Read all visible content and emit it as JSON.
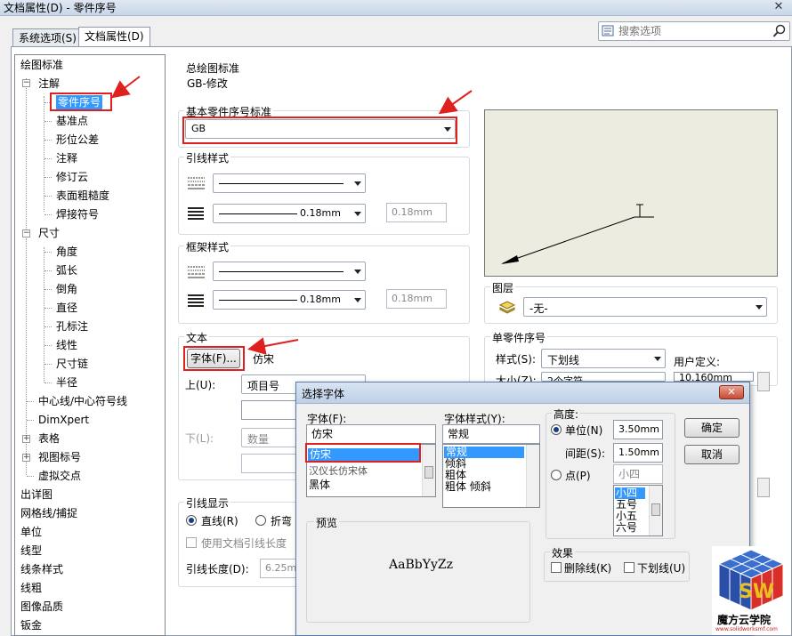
{
  "window": {
    "title": "文档属性(D) - 零件序号",
    "close_glyph": "✕"
  },
  "tabs": [
    {
      "label": "系统选项(S)",
      "active": false
    },
    {
      "label": "文档属性(D)",
      "active": true
    }
  ],
  "search": {
    "placeholder": "搜索选项"
  },
  "tree": {
    "items": [
      {
        "label": "绘图标准",
        "level": 0
      },
      {
        "label": "注解",
        "level": 1,
        "expander": "−"
      },
      {
        "label": "零件序号",
        "level": 2,
        "selected": true
      },
      {
        "label": "基准点",
        "level": 2
      },
      {
        "label": "形位公差",
        "level": 2
      },
      {
        "label": "注释",
        "level": 2
      },
      {
        "label": "修订云",
        "level": 2
      },
      {
        "label": "表面粗糙度",
        "level": 2
      },
      {
        "label": "焊接符号",
        "level": 2
      },
      {
        "label": "尺寸",
        "level": 1,
        "expander": "−"
      },
      {
        "label": "角度",
        "level": 2
      },
      {
        "label": "弧长",
        "level": 2
      },
      {
        "label": "倒角",
        "level": 2
      },
      {
        "label": "直径",
        "level": 2
      },
      {
        "label": "孔标注",
        "level": 2
      },
      {
        "label": "线性",
        "level": 2
      },
      {
        "label": "尺寸链",
        "level": 2
      },
      {
        "label": "半径",
        "level": 2
      },
      {
        "label": "中心线/中心符号线",
        "level": 1
      },
      {
        "label": "DimXpert",
        "level": 1
      },
      {
        "label": "表格",
        "level": 1,
        "expander": "+"
      },
      {
        "label": "视图标号",
        "level": 1,
        "expander": "+"
      },
      {
        "label": "虚拟交点",
        "level": 1
      },
      {
        "label": "出详图",
        "level": 0
      },
      {
        "label": "网格线/捕捉",
        "level": 0
      },
      {
        "label": "单位",
        "level": 0
      },
      {
        "label": "线型",
        "level": 0
      },
      {
        "label": "线条样式",
        "level": 0
      },
      {
        "label": "线粗",
        "level": 0
      },
      {
        "label": "图像品质",
        "level": 0
      },
      {
        "label": "钣金",
        "level": 0
      }
    ]
  },
  "overall_standard": {
    "label": "总绘图标准",
    "value": "GB-修改"
  },
  "base_standard": {
    "label": "基本零件序号标准",
    "value": "GB"
  },
  "leader_style": {
    "label": "引线样式",
    "thickness": "0.18mm",
    "custom": "0.18mm"
  },
  "frame_style": {
    "label": "框架样式",
    "thickness": "0.18mm",
    "custom": "0.18mm"
  },
  "text_group": {
    "label": "文本",
    "font_button": "字体(F)...",
    "font_name": "仿宋",
    "upper_label": "上(U):",
    "upper_value": "项目号",
    "lower_label": "下(L):",
    "lower_value": "数量"
  },
  "leader_display": {
    "label": "引线显示",
    "straight": "直线(R)",
    "bent": "折弯",
    "use_doc_length": "使用文档引线长度",
    "length_label": "引线长度(D):",
    "length_value": "6.25mm"
  },
  "layer": {
    "label": "图层",
    "value": "-无-"
  },
  "single_balloon": {
    "label": "单零件序号",
    "style_label": "样式(S):",
    "style_value": "下划线",
    "user_defined": "用户定义:",
    "size_label": "大小(Z):",
    "size_value": "2个字符",
    "user_value": "10.160mm"
  },
  "font_dialog": {
    "title": "选择字体",
    "close_glyph": "✕",
    "font_label": "字体(F):",
    "font_value": "仿宋",
    "font_options": [
      "仿宋",
      "汉仪长仿宋体",
      "黑体"
    ],
    "style_label": "字体样式(Y):",
    "style_value": "常规",
    "style_options": [
      "常规",
      "倾斜",
      "粗体",
      "粗体 倾斜"
    ],
    "height_label": "高度:",
    "units_label": "单位(N)",
    "units_value": "3.50mm",
    "spacing_label": "间距(S):",
    "spacing_value": "1.50mm",
    "points_label": "点(P)",
    "points_value": "小四",
    "points_options": [
      "小四",
      "五号",
      "小五",
      "六号"
    ],
    "ok": "确定",
    "cancel": "取消",
    "preview_label": "预览",
    "preview_text": "AaBbYyZz",
    "effects_label": "效果",
    "strikeout": "删除线(K)",
    "underline": "下划线(U)"
  },
  "logo": {
    "name": "魔方云学院",
    "url": "www.solidworksmf.com"
  },
  "colors": {
    "highlight": "#e0201e",
    "selection": "#3399ff"
  }
}
